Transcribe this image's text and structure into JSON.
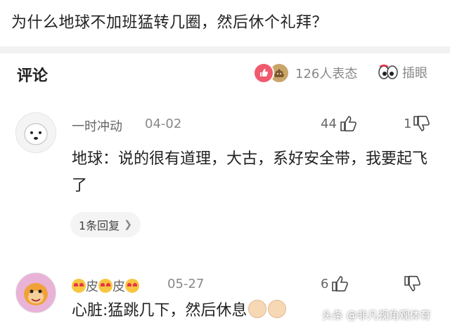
{
  "question": "为什么地球不加班猛转几圈，然后休个礼拜？",
  "comments_section": {
    "title": "评论",
    "reaction_count_text": "126人表态",
    "illustration_label": "插眼"
  },
  "comments": [
    {
      "username": "一时冲动",
      "date": "04-02",
      "likes": "44",
      "dislikes": "1",
      "text": "地球：说的很有道理，大古，系好安全带，我要起飞了",
      "reply_button": "1条回复"
    },
    {
      "username_part1": "皮",
      "username_part2": "皮",
      "date": "05-27",
      "likes": "6",
      "dislikes": "",
      "text": "心脏:猛跳几下，然后休息"
    }
  ],
  "watermark": "头条 @非凡视角观体育",
  "colors": {
    "like_badge": "#f05a6e",
    "text_primary": "#222222",
    "text_secondary": "#888888"
  }
}
